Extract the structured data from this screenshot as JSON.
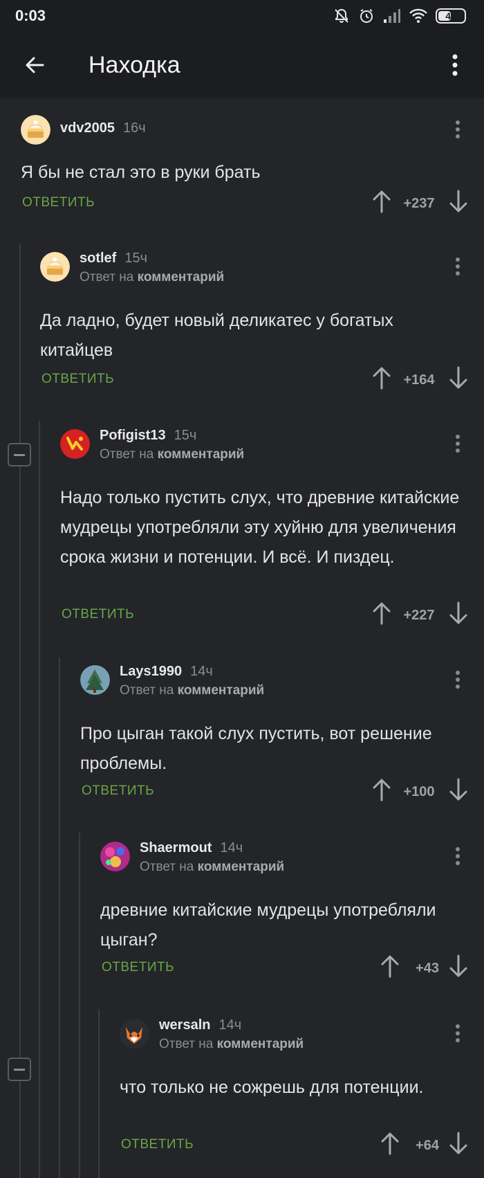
{
  "status": {
    "time": "0:03",
    "battery": "46",
    "battery_level": 0.46
  },
  "appbar": {
    "title": "Находка"
  },
  "reply_prefix": "Ответ на",
  "reply_link": "комментарий",
  "reply_label": "ОТВЕТИТЬ",
  "comments": [
    {
      "author": "vdv2005",
      "time": "16ч",
      "text": "Я бы не стал это в руки брать",
      "score": "+237",
      "is_reply": false,
      "avatar": "cake-avatar"
    },
    {
      "author": "sotlef",
      "time": "15ч",
      "text": "Да ладно, будет новый деликатес у богатых китайцев",
      "score": "+164",
      "is_reply": true,
      "avatar": "cake-avatar"
    },
    {
      "author": "Pofigist13",
      "time": "15ч",
      "text": "Надо только пустить слух, что древние китайские мудрецы употребляли эту хуйню для увеличения срока жизни и потенции. И всё. И пиздец.",
      "score": "+227",
      "is_reply": true,
      "avatar": "red-emblem-avatar"
    },
    {
      "author": "Lays1990",
      "time": "14ч",
      "text": "Про цыган такой слух пустить, вот решение проблемы.",
      "score": "+100",
      "is_reply": true,
      "avatar": "tree-avatar"
    },
    {
      "author": "Shaermout",
      "time": "14ч",
      "text": "древние китайские мудрецы употребляли цыган?",
      "score": "+43",
      "is_reply": true,
      "avatar": "colorful-avatar"
    },
    {
      "author": "wersaln",
      "time": "14ч",
      "text": "что только не сожрешь для потенции.",
      "score": "+64",
      "is_reply": true,
      "avatar": "fox-avatar"
    }
  ]
}
